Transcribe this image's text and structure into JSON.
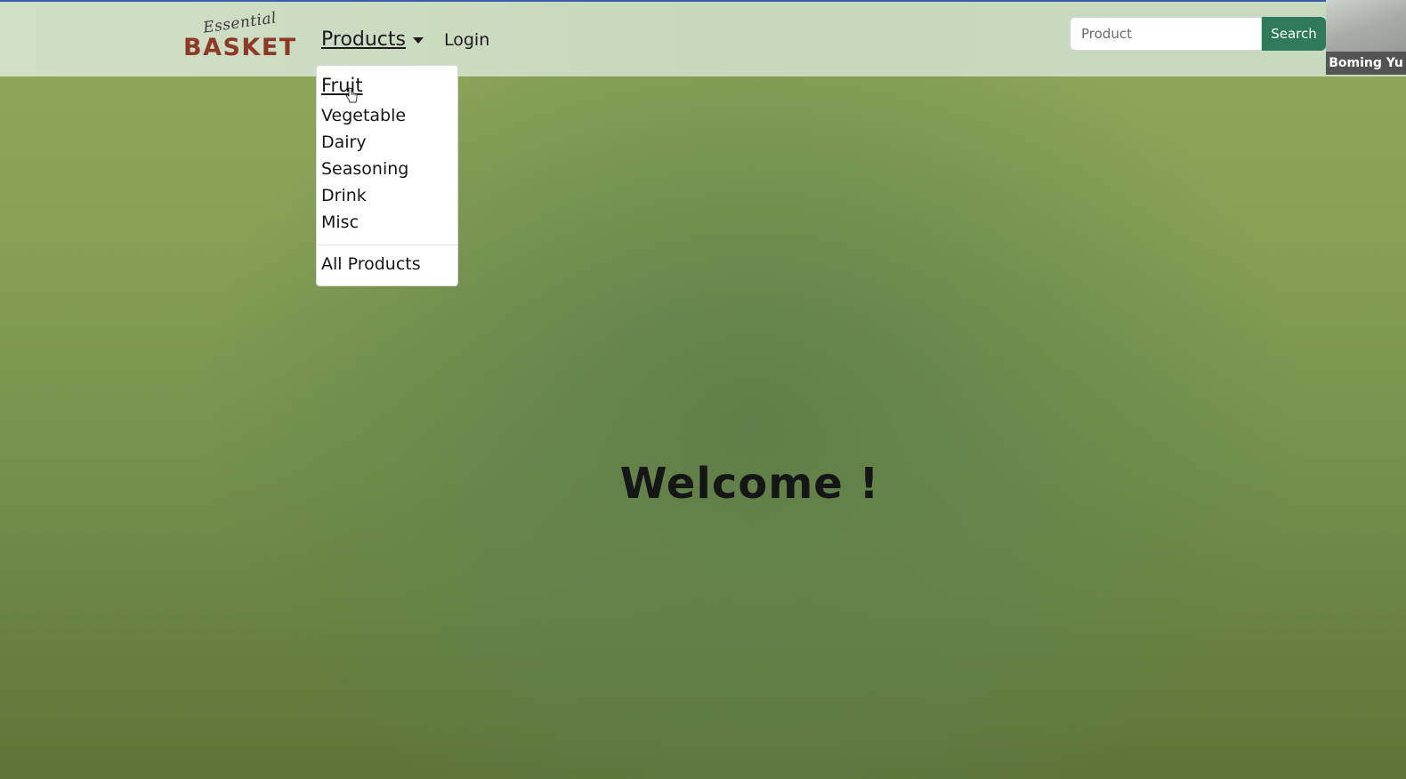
{
  "logo": {
    "script": "Essential",
    "main": "BASKET"
  },
  "nav": {
    "products_label": "Products",
    "login_label": "Login"
  },
  "search": {
    "placeholder": "Product",
    "value": "",
    "button_label": "Search"
  },
  "dropdown": {
    "items": [
      "Fruit",
      "Vegetable",
      "Dairy",
      "Seasoning",
      "Drink",
      "Misc"
    ],
    "all_label": "All Products",
    "hovered_item": "Fruit"
  },
  "welcome": {
    "text": "Welcome !"
  },
  "participant": {
    "name": "Boming Yu"
  },
  "colors": {
    "brand_red": "#8c3a25",
    "search_button": "#2e7a5a",
    "background_green": "#86a054"
  }
}
